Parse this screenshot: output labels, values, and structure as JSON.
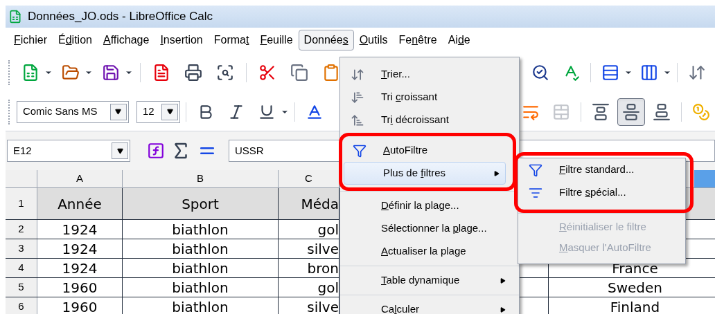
{
  "window": {
    "title": "Données_JO.ods - LibreOffice Calc"
  },
  "menubar": [
    {
      "label": {
        "key": "F",
        "post": "ichier"
      },
      "selected": false
    },
    {
      "label": {
        "pre": "É",
        "key": "d",
        "post": "ition"
      },
      "selected": false
    },
    {
      "label": {
        "key": "A",
        "post": "ffichage"
      },
      "selected": false
    },
    {
      "label": {
        "key": "I",
        "post": "nsertion"
      },
      "selected": false
    },
    {
      "label": {
        "pre": "Forma",
        "key": "t"
      },
      "selected": false
    },
    {
      "label": {
        "key": "F",
        "post": "euille"
      },
      "selected": false
    },
    {
      "label": {
        "pre": "Donnée",
        "key": "s"
      },
      "selected": true
    },
    {
      "label": {
        "key": "O",
        "post": "utils"
      },
      "selected": false
    },
    {
      "label": {
        "pre": "Fe",
        "key": "n",
        "post": "être"
      },
      "selected": false
    },
    {
      "label": {
        "pre": "Ai",
        "key": "d",
        "post": "e"
      },
      "selected": false
    }
  ],
  "toolbar1": {
    "left": [
      {
        "kind": "new",
        "dropdown": true
      },
      {
        "kind": "open",
        "dropdown": true
      },
      {
        "kind": "save",
        "dropdown": true
      },
      {
        "kind": "sep"
      },
      {
        "kind": "pdf",
        "dropdown": false
      },
      {
        "kind": "print",
        "dropdown": false
      },
      {
        "kind": "preview",
        "dropdown": false
      },
      {
        "kind": "sep"
      },
      {
        "kind": "cut",
        "dropdown": false
      },
      {
        "kind": "copy",
        "dropdown": false
      },
      {
        "kind": "paste",
        "dropdown": false
      }
    ],
    "right": [
      {
        "kind": "find",
        "dropdown": false
      },
      {
        "kind": "spell",
        "dropdown": false
      },
      {
        "kind": "sep"
      },
      {
        "kind": "rows",
        "dropdown": true
      },
      {
        "kind": "columns",
        "dropdown": true
      },
      {
        "kind": "sep"
      },
      {
        "kind": "sort",
        "dropdown": false
      }
    ]
  },
  "toolbar2": {
    "font": "Comic Sans MS",
    "size": "12",
    "left": [
      {
        "kind": "bold",
        "dropdown": false,
        "selected": false,
        "disabled": false
      },
      {
        "kind": "italic",
        "dropdown": false,
        "selected": false,
        "disabled": false
      },
      {
        "kind": "underline",
        "dropdown": true,
        "selected": false,
        "disabled": false
      },
      {
        "kind": "sep"
      },
      {
        "kind": "fontcolor",
        "dropdown": false,
        "selected": false,
        "disabled": false
      }
    ],
    "right": [
      {
        "kind": "wrap",
        "dropdown": false,
        "selected": false,
        "disabled": false
      },
      {
        "kind": "merge",
        "dropdown": false,
        "selected": false,
        "disabled": true
      },
      {
        "kind": "sep"
      },
      {
        "kind": "align-top",
        "dropdown": false,
        "selected": false,
        "disabled": false
      },
      {
        "kind": "align-center",
        "dropdown": false,
        "selected": true,
        "disabled": false
      },
      {
        "kind": "align-bottom",
        "dropdown": false,
        "selected": false,
        "disabled": false
      },
      {
        "kind": "sep"
      },
      {
        "kind": "currency",
        "dropdown": false,
        "selected": false,
        "disabled": false
      }
    ]
  },
  "formula_bar": {
    "cell": "E12",
    "value": "USSR"
  },
  "sheet": {
    "columns": [
      {
        "label": "A",
        "selected": false
      },
      {
        "label": "B",
        "selected": false
      },
      {
        "label": "C",
        "selected": false
      },
      {
        "selected": true
      }
    ],
    "rows": [
      {
        "number": "1",
        "header": true,
        "cells": [
          "Année",
          "Sport",
          "Méda"
        ]
      },
      {
        "number": "2",
        "header": false,
        "cells": [
          "1924",
          "biathlon",
          "gol"
        ]
      },
      {
        "number": "3",
        "header": false,
        "cells": [
          "1924",
          "biathlon",
          "silve"
        ]
      },
      {
        "number": "4",
        "header": false,
        "cells": [
          "1924",
          "biathlon",
          "bron",
          "France"
        ]
      },
      {
        "number": "5",
        "header": false,
        "cells": [
          "1960",
          "biathlon",
          "gol",
          "Sweden"
        ]
      },
      {
        "number": "6",
        "header": false,
        "cells": [
          "1960",
          "biathlon",
          "silve",
          "Finland"
        ]
      }
    ]
  },
  "menu": {
    "groups": [
      {
        "circled": false,
        "items": [
          {
            "kind": "sort",
            "label": {
              "key": "T",
              "post": "rier..."
            },
            "submenu": false,
            "highlighted": false
          },
          {
            "kind": "sort-asc",
            "label": {
              "pre": "Tri ",
              "key": "c",
              "post": "roissant"
            },
            "submenu": false,
            "highlighted": false
          },
          {
            "kind": "sort-desc",
            "label": {
              "pre": "Tr",
              "key": "i",
              "post": " décroissant"
            },
            "submenu": false,
            "highlighted": false
          }
        ]
      },
      {
        "circled": true,
        "items": [
          {
            "kind": "autofilter",
            "label": {
              "key": "A",
              "post": "utoFiltre"
            },
            "submenu": false,
            "highlighted": false
          },
          {
            "kind": "none",
            "label": {
              "pre": "Plus de ",
              "key": "f",
              "post": "iltres"
            },
            "submenu": true,
            "highlighted": true
          }
        ]
      },
      {
        "circled": false,
        "items": [
          {
            "kind": "none",
            "label": {
              "key": "D",
              "post": "éfinir la plage..."
            },
            "submenu": false,
            "highlighted": false
          },
          {
            "kind": "none",
            "label": {
              "pre": "Sélectionner la ",
              "key": "p",
              "post": "lage..."
            },
            "submenu": false,
            "highlighted": false
          },
          {
            "kind": "none",
            "label": {
              "key": "A",
              "post": "ctualiser la plage"
            },
            "submenu": false,
            "highlighted": false
          }
        ]
      },
      {
        "circled": false,
        "items": [
          {
            "kind": "none",
            "label": {
              "key": "T",
              "post": "able dynamique"
            },
            "submenu": true,
            "highlighted": false
          }
        ]
      },
      {
        "circled": false,
        "items": [
          {
            "kind": "none",
            "label": {
              "pre": "Ca",
              "key": "l",
              "post": "culer"
            },
            "submenu": true,
            "highlighted": false
          }
        ]
      }
    ]
  },
  "submenu": {
    "groups": [
      {
        "circled": true,
        "items": [
          {
            "kind": "standard-filter",
            "label": {
              "key": "F",
              "post": "iltre standard..."
            },
            "disabled": false
          },
          {
            "kind": "special-filter",
            "label": {
              "pre": "Filtre ",
              "key": "s",
              "post": "pécial..."
            },
            "disabled": false
          }
        ]
      },
      {
        "circled": false,
        "items": [
          {
            "kind": "none",
            "label": {
              "key": "R",
              "post": "éinitialiser le filtre"
            },
            "disabled": true
          },
          {
            "kind": "none",
            "label": {
              "key": "M",
              "post": "asquer l'AutoFiltre"
            },
            "disabled": true
          }
        ]
      }
    ]
  }
}
